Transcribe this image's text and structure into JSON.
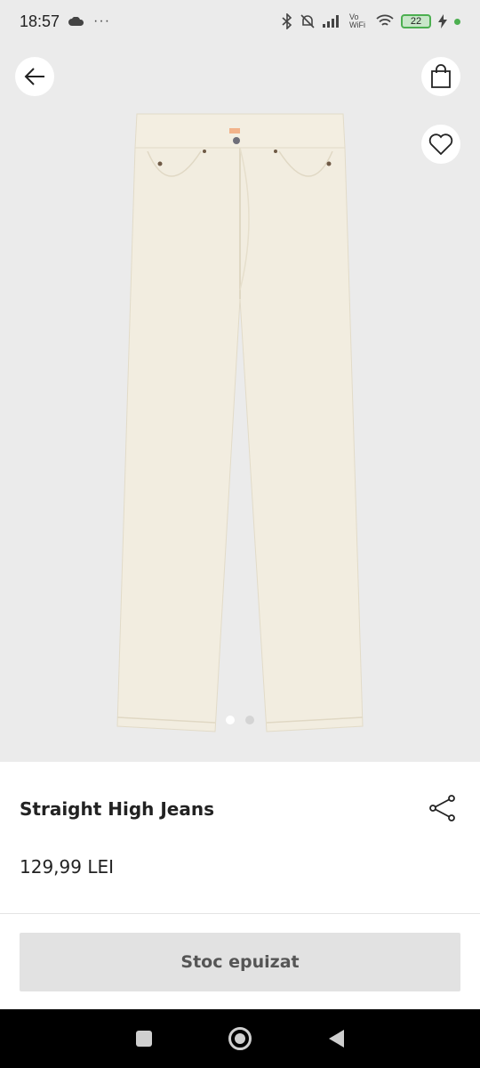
{
  "status_bar": {
    "time": "18:57",
    "more": "···",
    "network": "Vo WiFi",
    "battery": "22"
  },
  "product": {
    "title": "Straight High Jeans",
    "price": "129,99 LEI",
    "image_count": 2,
    "active_image": 1
  },
  "actions": {
    "cta_label": "Stoc epuizat"
  },
  "icons": {
    "back": "arrow-left-icon",
    "bag": "shopping-bag-icon",
    "favorite": "heart-icon",
    "share": "share-icon"
  },
  "colors": {
    "hero_background": "#ebebeb",
    "product_color": "#f2ede0",
    "cta_background": "#e2e2e2",
    "charging": "#4caf50"
  }
}
